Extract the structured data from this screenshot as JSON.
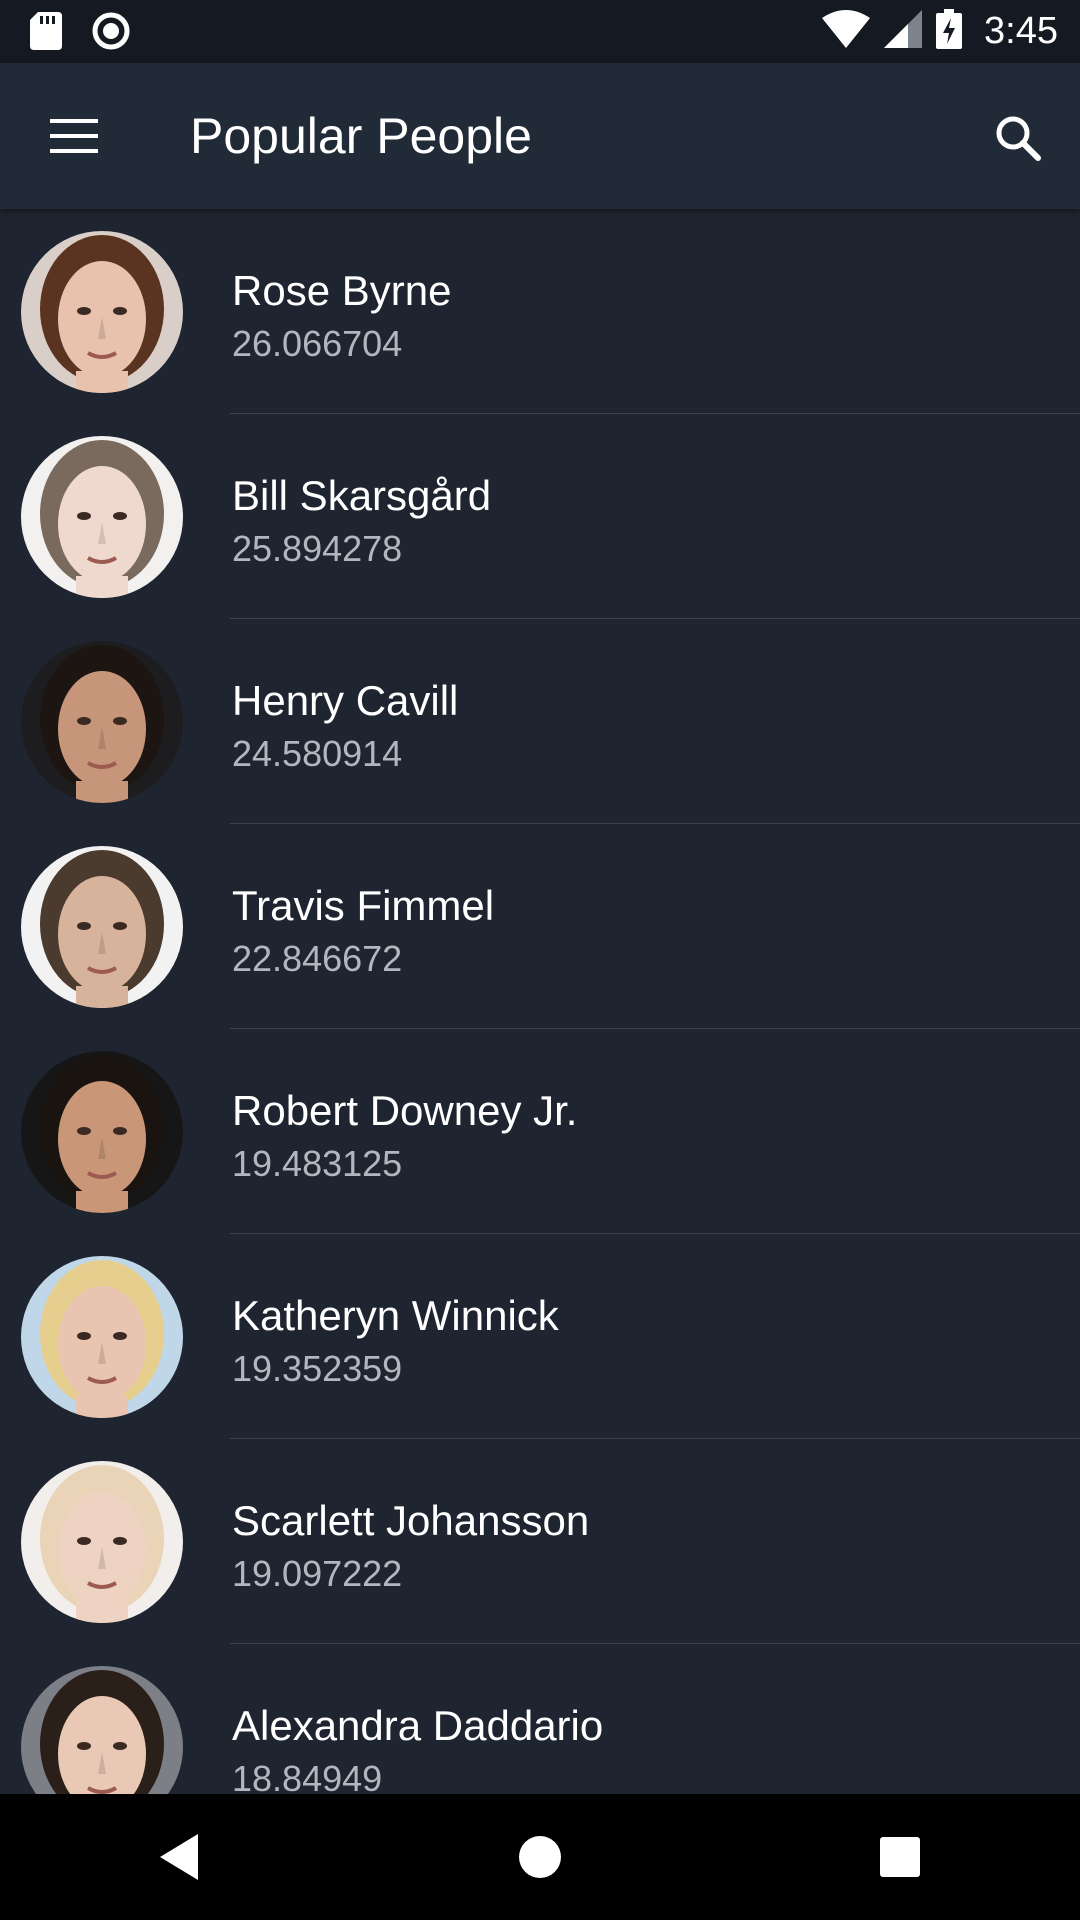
{
  "status_bar": {
    "time": "3:45",
    "icons": [
      "sd-card-icon",
      "sync-circle-icon",
      "wifi-icon",
      "cell-signal-icon",
      "battery-charging-icon"
    ]
  },
  "app_bar": {
    "title": "Popular People",
    "menu_icon": "hamburger-menu-icon",
    "search_icon": "search-icon"
  },
  "people": [
    {
      "name": "Rose Byrne",
      "popularity": "26.066704",
      "skin": "#e9c2ad",
      "hair": "#5a3420",
      "bg": "#d9cfc8"
    },
    {
      "name": "Bill Skarsgård",
      "popularity": "25.894278",
      "skin": "#efd9cf",
      "hair": "#7a6a5e",
      "bg": "#f3f1ef"
    },
    {
      "name": "Henry Cavill",
      "popularity": "24.580914",
      "skin": "#c7957a",
      "hair": "#1c1512",
      "bg": "#1d1d1f"
    },
    {
      "name": "Travis Fimmel",
      "popularity": "22.846672",
      "skin": "#d8b39c",
      "hair": "#4b3a2e",
      "bg": "#f2f2f2"
    },
    {
      "name": "Robert Downey Jr.",
      "popularity": "19.483125",
      "skin": "#c99778",
      "hair": "#1a1411",
      "bg": "#161616"
    },
    {
      "name": "Katheryn Winnick",
      "popularity": "19.352359",
      "skin": "#e8c4b1",
      "hair": "#e6cf8e",
      "bg": "#bfd7e8"
    },
    {
      "name": "Scarlett Johansson",
      "popularity": "19.097222",
      "skin": "#eed2c2",
      "hair": "#e9d4b8",
      "bg": "#f1eeec"
    },
    {
      "name": "Alexandra Daddario",
      "popularity": "18.84949",
      "skin": "#e9c8b6",
      "hair": "#2b1f1a",
      "bg": "#7c7f86"
    }
  ],
  "nav_bar": {
    "back_icon": "back-triangle-icon",
    "home_icon": "home-circle-icon",
    "recents_icon": "recents-square-icon"
  },
  "colors": {
    "background": "#1f2530",
    "app_bar": "#212a37",
    "status_bar": "#151a22",
    "primary_text": "#ffffff",
    "secondary_text": "#b2b7bf",
    "divider": "#3a4250"
  }
}
